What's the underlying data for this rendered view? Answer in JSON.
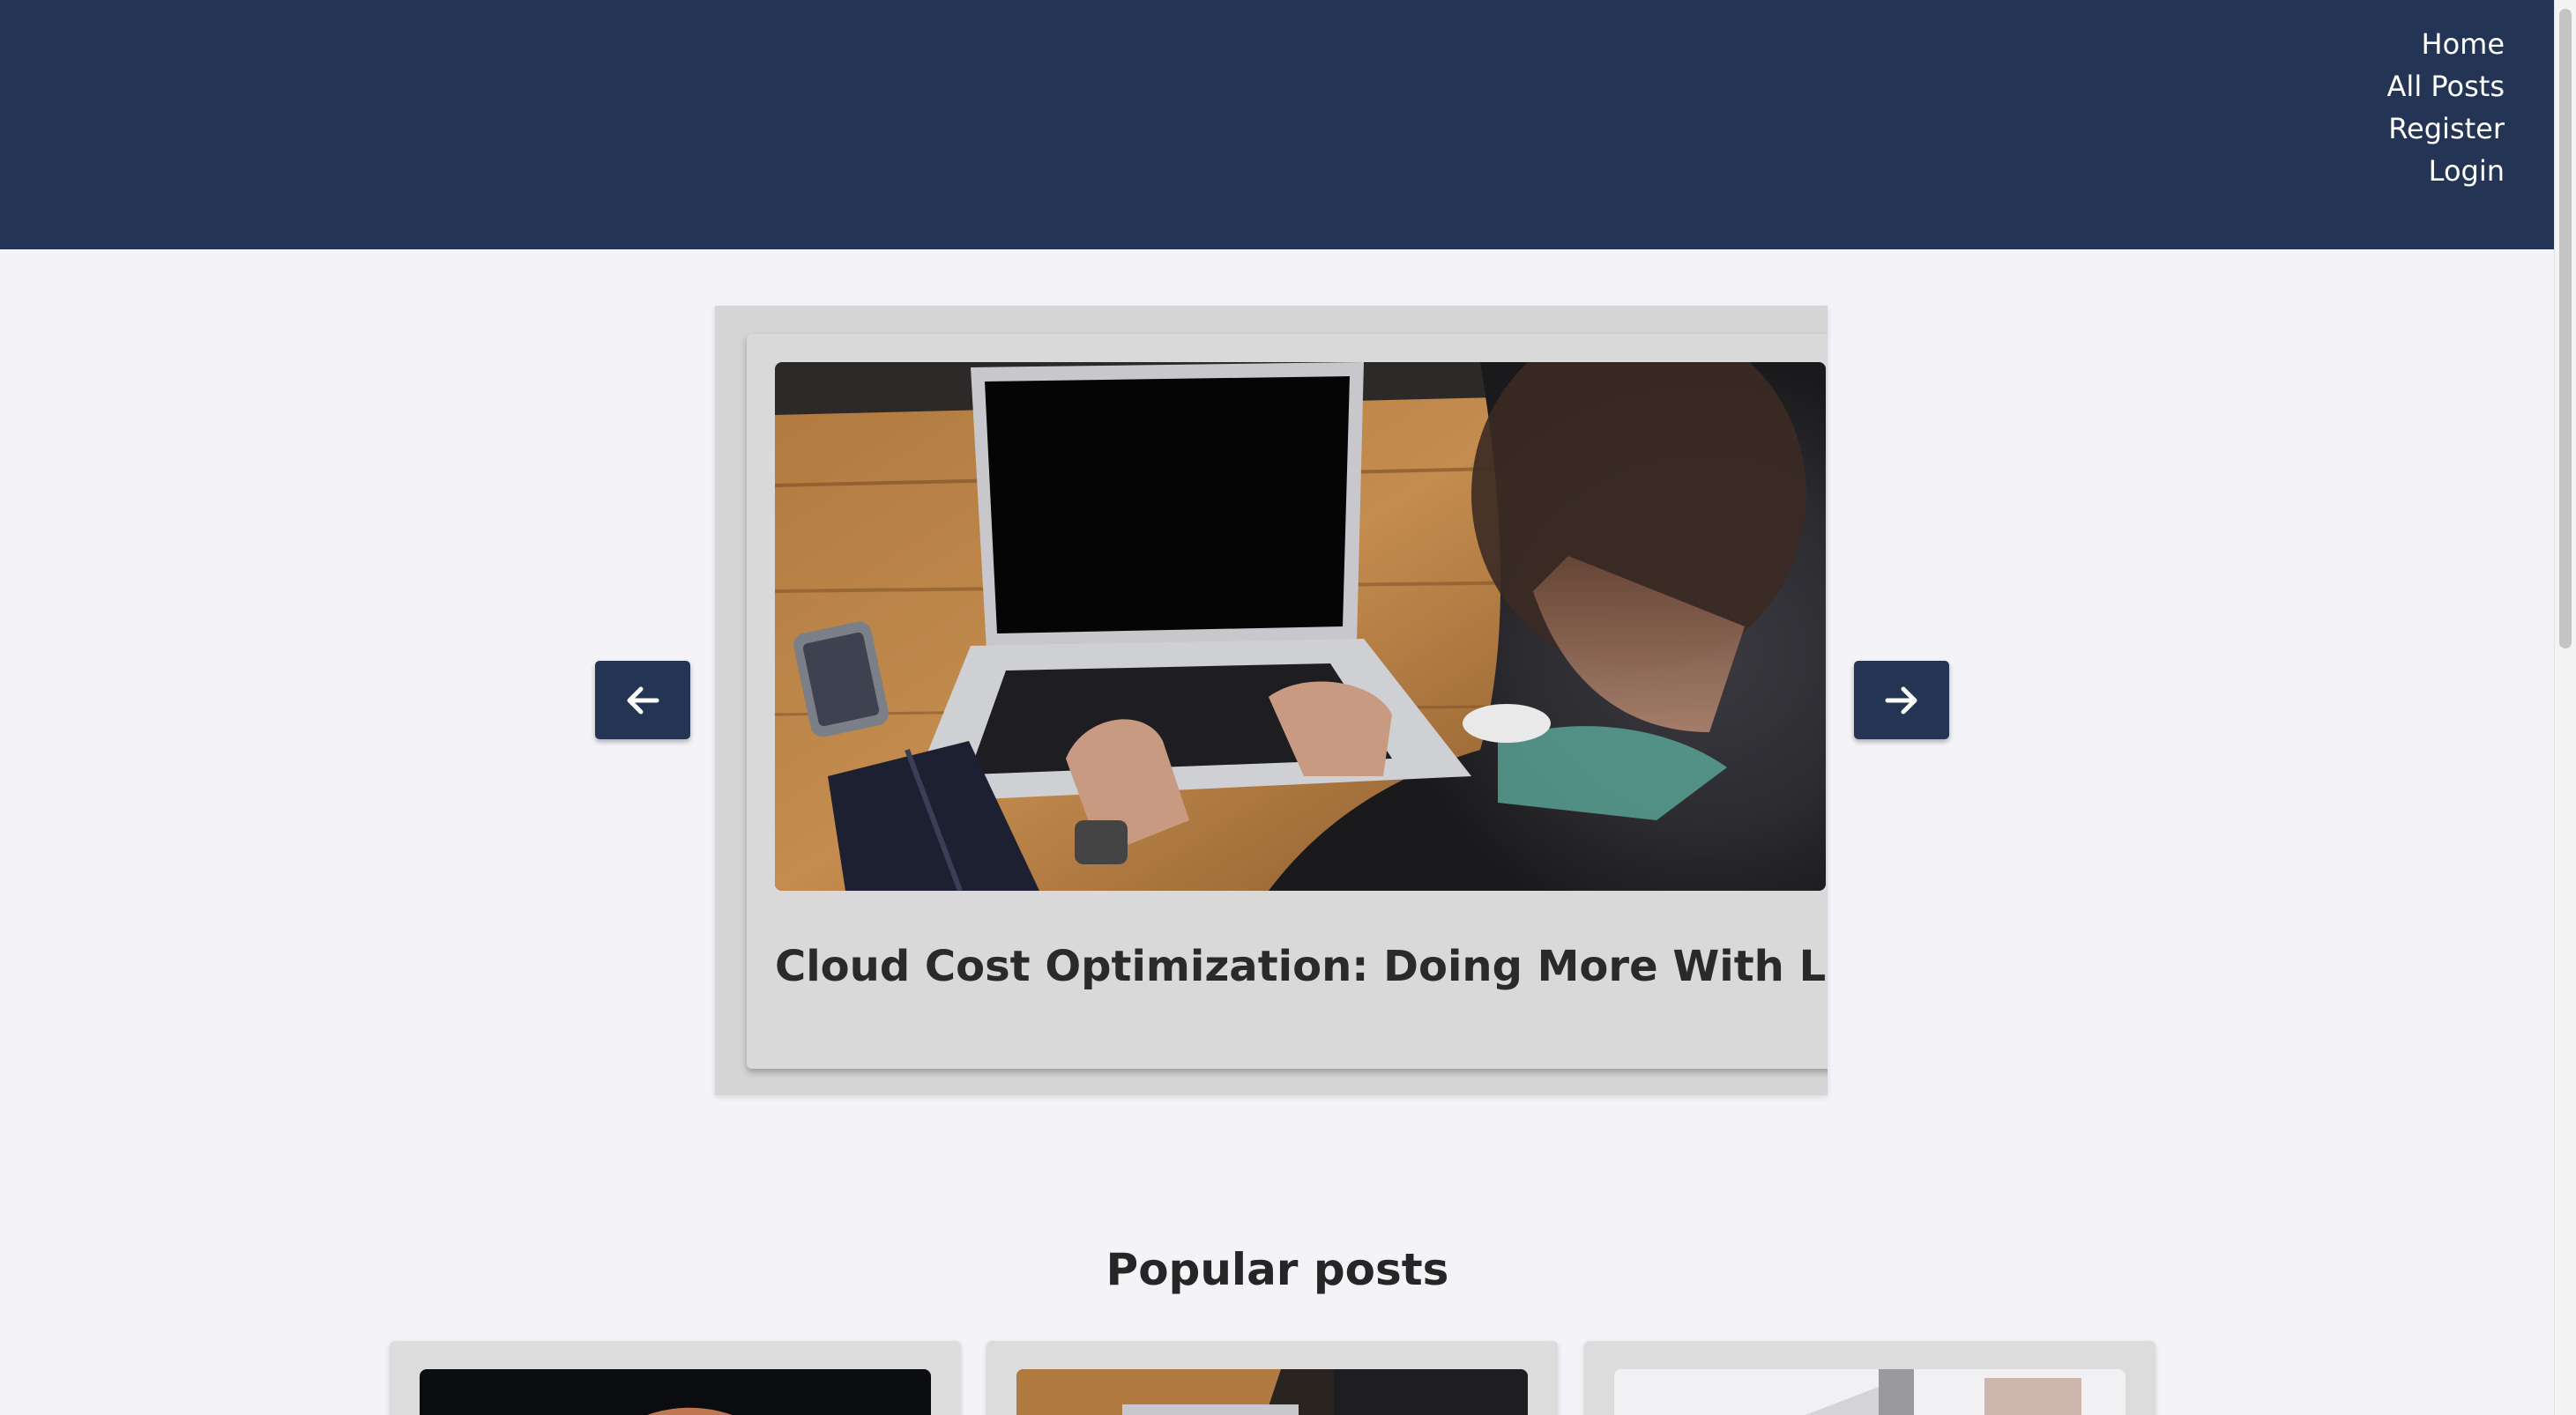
{
  "nav": {
    "links": [
      "Home",
      "All Posts",
      "Register",
      "Login"
    ]
  },
  "carousel": {
    "slide_title": "Cloud Cost Optimization: Doing More With Less",
    "prev_icon": "arrow-left-icon",
    "next_icon": "arrow-right-icon"
  },
  "popular": {
    "heading": "Popular posts"
  },
  "colors": {
    "header_bg": "#243454",
    "page_bg": "#f4f4f8",
    "card_bg": "#d9d9d9",
    "button_bg": "#243454"
  }
}
